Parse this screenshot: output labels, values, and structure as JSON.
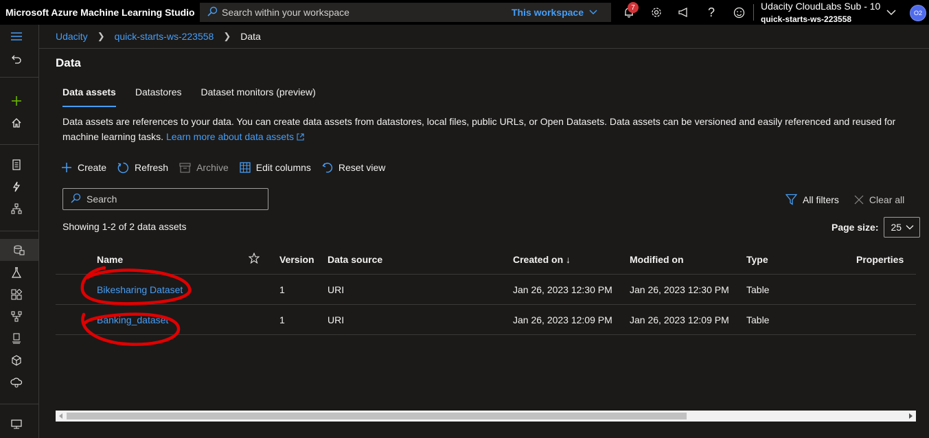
{
  "app": {
    "title": "Microsoft Azure Machine Learning Studio"
  },
  "search": {
    "placeholder": "Search within your workspace",
    "scope": "This workspace"
  },
  "notifications": {
    "count": "7"
  },
  "account": {
    "subscription": "Udacity CloudLabs Sub - 10",
    "workspace": "quick-starts-ws-223558",
    "initials": "O2"
  },
  "breadcrumb": {
    "items": [
      "Udacity",
      "quick-starts-ws-223558"
    ],
    "current": "Data"
  },
  "page": {
    "title": "Data"
  },
  "tabs": [
    "Data assets",
    "Datastores",
    "Dataset monitors (preview)"
  ],
  "description": {
    "text": "Data assets are references to your data. You can create data assets from datastores, local files, public URLs, or Open Datasets. Data assets can be versioned and easily referenced and reused for machine learning tasks.",
    "link": "Learn more about data assets"
  },
  "toolbar": {
    "create": "Create",
    "refresh": "Refresh",
    "archive": "Archive",
    "edit_columns": "Edit columns",
    "reset_view": "Reset view"
  },
  "filter": {
    "placeholder": "Search",
    "all_filters": "All filters",
    "clear_all": "Clear all"
  },
  "list": {
    "showing": "Showing 1-2 of 2 data assets",
    "page_size_label": "Page size:",
    "page_size": "25"
  },
  "columns": [
    "Name",
    "Version",
    "Data source",
    "Created on",
    "Modified on",
    "Type",
    "Properties"
  ],
  "sort_indicator": "↓",
  "rows": [
    {
      "name": "Bikesharing Dataset",
      "version": "1",
      "source": "URI",
      "created": "Jan 26, 2023 12:30 PM",
      "modified": "Jan 26, 2023 12:30 PM",
      "type": "Table"
    },
    {
      "name": "Banking_dataset",
      "version": "1",
      "source": "URI",
      "created": "Jan 26, 2023 12:09 PM",
      "modified": "Jan 26, 2023 12:09 PM",
      "type": "Table"
    }
  ],
  "colors": {
    "accent": "#479ef5",
    "annotation": "#e00000",
    "background": "#1b1a19",
    "topbar": "#000000"
  }
}
